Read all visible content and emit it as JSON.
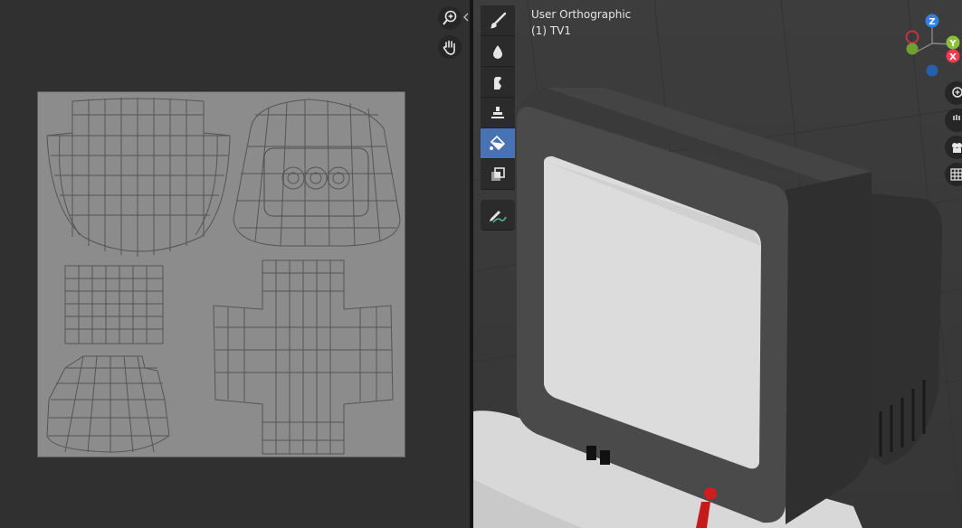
{
  "viewport": {
    "view_name": "User Orthographic",
    "object_label": "(1) TV1"
  },
  "gizmo": {
    "z_label": "Z",
    "y_label": "Y",
    "x_label": "X",
    "colors": {
      "x": "#e8404f",
      "y": "#8ac13a",
      "z": "#2f83e3"
    }
  },
  "toolbar": {
    "tools": [
      "draw-brush-icon",
      "soften-icon",
      "smear-icon",
      "clone-icon",
      "fill-icon",
      "mask-icon"
    ],
    "active_tool": "fill-icon",
    "annotate_tool": "annotate-icon"
  },
  "uv_editor": {
    "nav_tools": [
      "zoom-icon",
      "pan-icon"
    ]
  },
  "colors": {
    "accent": "#4772b3"
  }
}
